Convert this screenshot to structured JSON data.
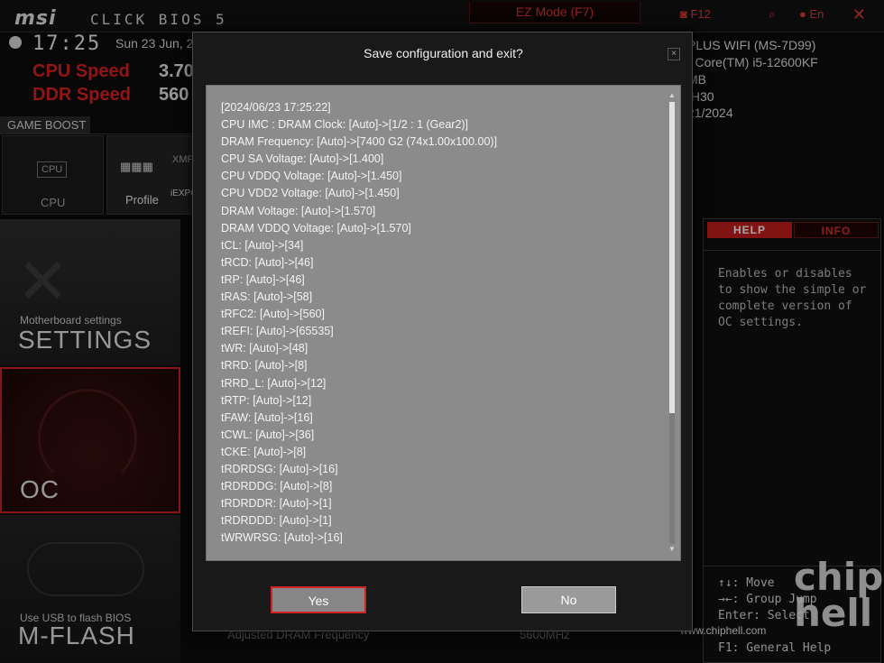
{
  "header": {
    "logo": "msi",
    "product": "CLICK BIOS 5",
    "ez_mode": "EZ Mode (F7)",
    "screenshot_key": "F12",
    "language": "En"
  },
  "status": {
    "time": "17:25",
    "date": "Sun 23 Jun, 2",
    "cpu_speed_label": "CPU Speed",
    "cpu_speed_value": "3.70",
    "ddr_speed_label": "DDR Speed",
    "ddr_speed_value": "560",
    "sysinfo": [
      "PLUS WIFI (MS-7D99)",
      ") Core(TM) i5-12600KF",
      "MB",
      ".H30",
      "21/2024"
    ]
  },
  "game_boost": {
    "label": "GAME BOOST",
    "cpu_label": "CPU",
    "profile_label": "Profile",
    "xmp_label": "XMP",
    "iexpo_label": "iEXPO"
  },
  "nav": {
    "settings_sub": "Motherboard settings",
    "settings_title": "SETTINGS",
    "oc_title": "OC",
    "mflash_sub": "Use USB to flash BIOS",
    "mflash_title": "M-FLASH"
  },
  "help_panel": {
    "tab_help": "HELP",
    "tab_info": "INFO",
    "text": "Enables or disables to show the simple or complete version of OC settings.",
    "keys": [
      "↑↓: Move",
      "→←: Group Jump",
      "Enter: Select",
      "F1: General Help"
    ]
  },
  "background_row": {
    "label": "Adjusted DRAM Frequency",
    "value": "5600MHz"
  },
  "watermark": {
    "url": "www.chiphell.com",
    "logo": "chip hell"
  },
  "dialog": {
    "title": "Save configuration and exit?",
    "close": "×",
    "lines": [
      "[2024/06/23 17:25:22]",
      "CPU IMC : DRAM Clock: [Auto]->[1/2 : 1 (Gear2)]",
      "DRAM Frequency: [Auto]->[7400 G2 (74x1.00x100.00)]",
      "CPU SA Voltage: [Auto]->[1.400]",
      "CPU VDDQ Voltage: [Auto]->[1.450]",
      "CPU VDD2 Voltage: [Auto]->[1.450]",
      "DRAM Voltage: [Auto]->[1.570]",
      "DRAM VDDQ Voltage: [Auto]->[1.570]",
      "tCL: [Auto]->[34]",
      "tRCD: [Auto]->[46]",
      "tRP: [Auto]->[46]",
      "tRAS: [Auto]->[58]",
      "tRFC2: [Auto]->[560]",
      "tREFI: [Auto]->[65535]",
      "tWR: [Auto]->[48]",
      "tRRD: [Auto]->[8]",
      "tRRD_L: [Auto]->[12]",
      "tRTP: [Auto]->[12]",
      "tFAW: [Auto]->[16]",
      "tCWL: [Auto]->[36]",
      "tCKE: [Auto]->[8]",
      "tRDRDSG: [Auto]->[16]",
      "tRDRDDG: [Auto]->[8]",
      "tRDRDDR: [Auto]->[1]",
      "tRDRDDD: [Auto]->[1]",
      "tWRWRSG: [Auto]->[16]"
    ],
    "yes_label": "Yes",
    "no_label": "No",
    "scroll_up": "▲",
    "scroll_down": "▼"
  },
  "colors": {
    "accent": "#d32222",
    "dialog_bg": "#191919",
    "log_bg": "#8b8b8b"
  }
}
